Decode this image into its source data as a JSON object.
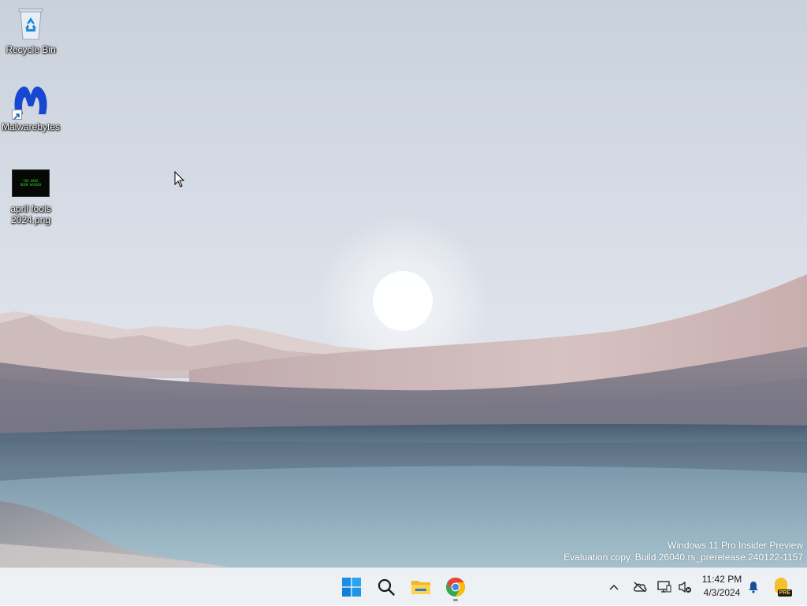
{
  "desktop": {
    "icons": [
      {
        "label": "Recycle Bin"
      },
      {
        "label": "Malwarebytes"
      },
      {
        "label": "april fools 2024.png"
      }
    ],
    "thumbnail_text": "YOU HAVE BEEN HACKED"
  },
  "watermark": {
    "line1": "Windows 11 Pro Insider Preview",
    "line2": "Evaluation copy. Build 26040.rs_prerelease.240122-1157"
  },
  "taskbar": {
    "apps": [
      {
        "icon": "windows-start-icon"
      },
      {
        "icon": "search-icon"
      },
      {
        "icon": "file-explorer-icon"
      },
      {
        "icon": "chrome-icon",
        "running": true
      }
    ],
    "tray": {
      "icons": [
        "chevron-up-icon",
        "onedrive-offline-icon",
        "display-icon",
        "volume-muted-icon"
      ],
      "time": "11:42 PM",
      "date": "4/3/2024",
      "badge": "PRE"
    }
  },
  "colors": {
    "accent": "#0067c0",
    "taskbar_bg": "#eef1f4"
  }
}
